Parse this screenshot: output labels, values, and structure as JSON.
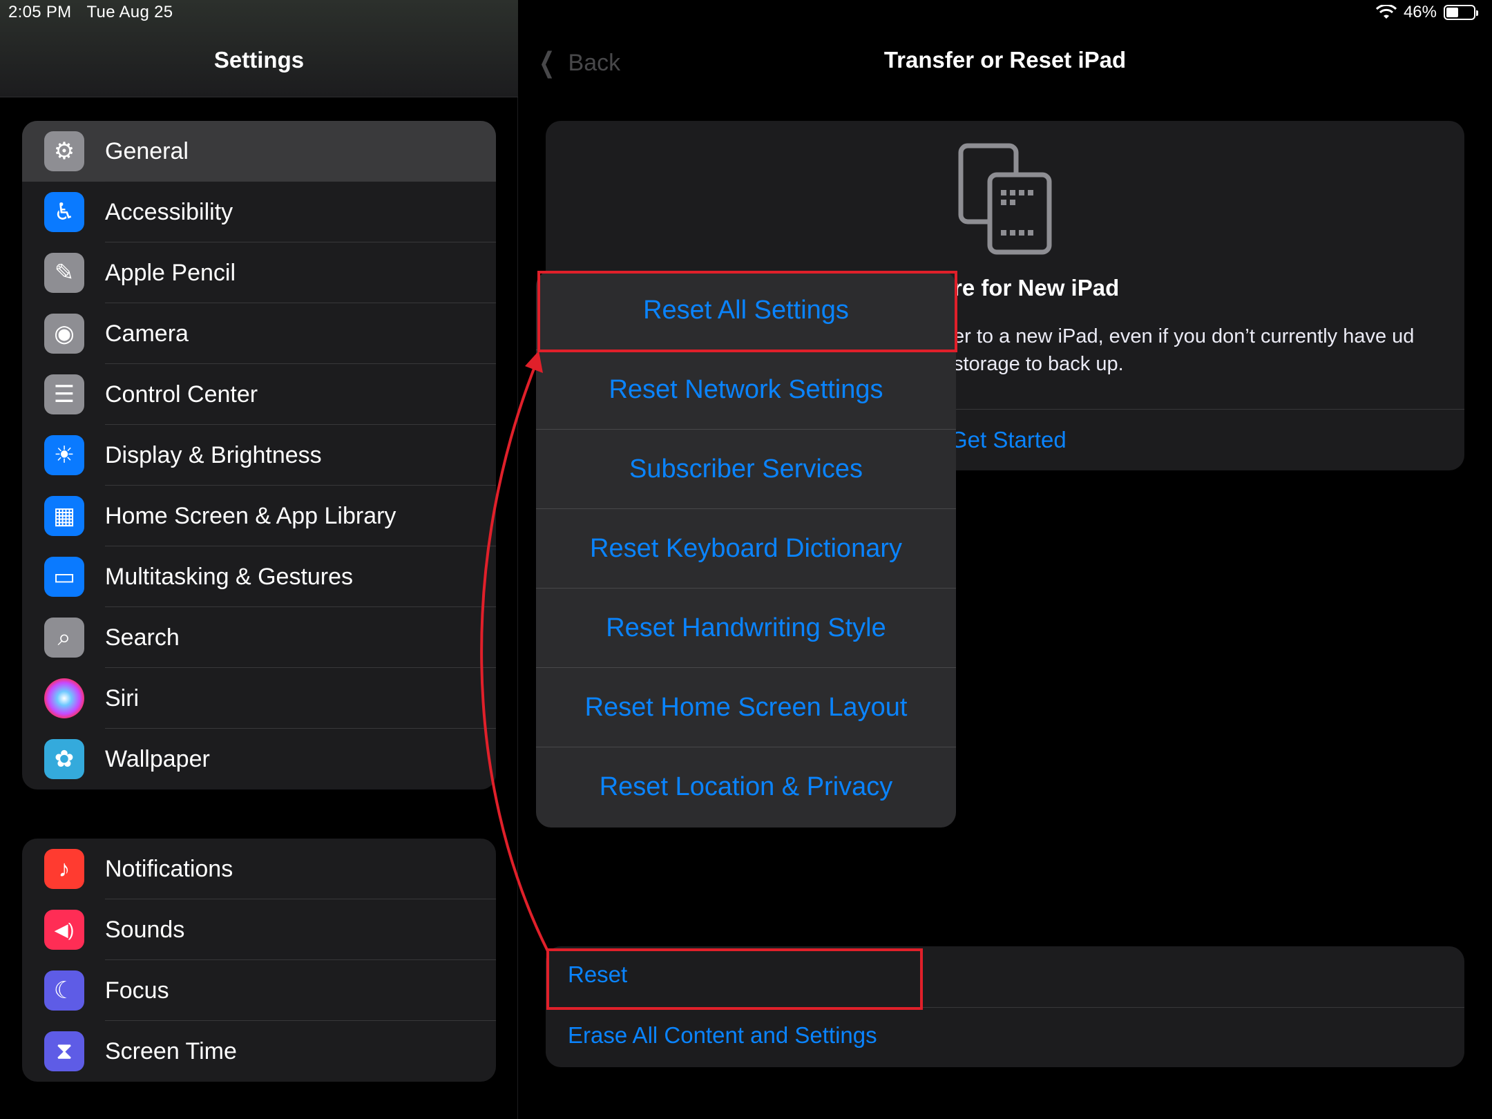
{
  "status_bar": {
    "time": "2:05 PM",
    "date": "Tue Aug 25",
    "battery": "46%",
    "battery_level": 0.46
  },
  "sidebar": {
    "title": "Settings",
    "group1": [
      {
        "label": "General",
        "icon": "gear-icon",
        "color": "#8e8e93",
        "selected": true
      },
      {
        "label": "Accessibility",
        "icon": "accessibility-icon",
        "color": "#0a7aff"
      },
      {
        "label": "Apple Pencil",
        "icon": "pencil-icon",
        "color": "#8e8e93"
      },
      {
        "label": "Camera",
        "icon": "camera-icon",
        "color": "#8e8e93"
      },
      {
        "label": "Control Center",
        "icon": "switches-icon",
        "color": "#8e8e93"
      },
      {
        "label": "Display & Brightness",
        "icon": "sun-icon",
        "color": "#0a7aff"
      },
      {
        "label": "Home Screen & App Library",
        "icon": "home-screen-icon",
        "color": "#0a7aff"
      },
      {
        "label": "Multitasking & Gestures",
        "icon": "multitasking-icon",
        "color": "#0a7aff"
      },
      {
        "label": "Search",
        "icon": "search-icon",
        "color": "#8e8e93"
      },
      {
        "label": "Siri",
        "icon": "siri-icon",
        "color": "#1c1c1e"
      },
      {
        "label": "Wallpaper",
        "icon": "flower-icon",
        "color": "#34aadc"
      }
    ],
    "group2": [
      {
        "label": "Notifications",
        "icon": "bell-icon",
        "color": "#ff3b30"
      },
      {
        "label": "Sounds",
        "icon": "speaker-icon",
        "color": "#ff2d55"
      },
      {
        "label": "Focus",
        "icon": "moon-icon",
        "color": "#5e5ce6"
      },
      {
        "label": "Screen Time",
        "icon": "hourglass-icon",
        "color": "#5e5ce6"
      }
    ]
  },
  "detail": {
    "back_label": "Back",
    "title": "Transfer or Reset iPad",
    "prepare_title": "re for New iPad",
    "prepare_text": "er to a new iPad, even if you don’t currently have ud storage to back up.",
    "get_started": "Get Started",
    "reset": "Reset",
    "erase": "Erase All Content and Settings"
  },
  "reset_menu": [
    "Reset All Settings",
    "Reset Network Settings",
    "Subscriber Services",
    "Reset Keyboard Dictionary",
    "Reset Handwriting Style",
    "Reset Home Screen Layout",
    "Reset Location & Privacy"
  ],
  "annotation_color": "#e0202a"
}
